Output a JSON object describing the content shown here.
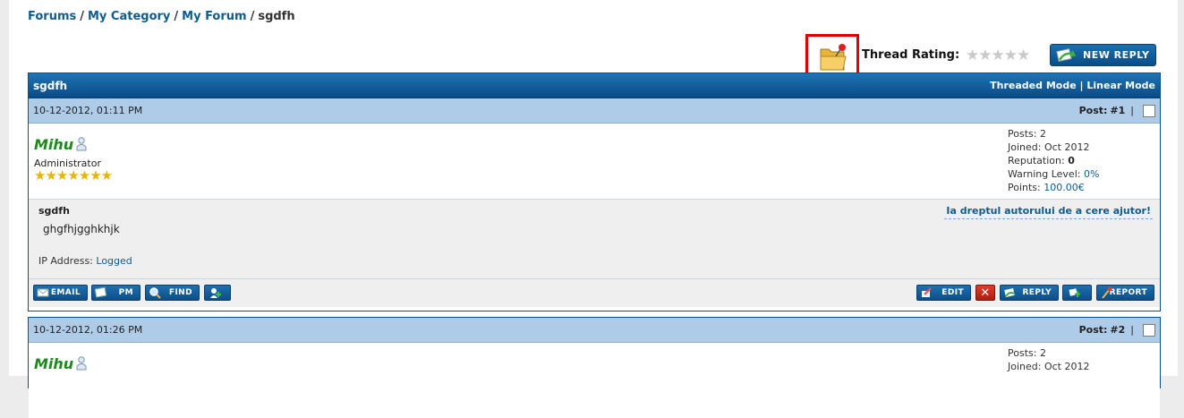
{
  "breadcrumb": {
    "forums": "Forums",
    "category": "My Category",
    "forum": "My Forum",
    "thread": "sgdfh",
    "sep": "/"
  },
  "thread_tools": {
    "rating_label": "Thread Rating:",
    "stars": "★★★★★",
    "new_reply": "NEW REPLY"
  },
  "thread": {
    "title": "sgdfh",
    "threaded_mode": "Threaded Mode",
    "linear_mode": "Linear Mode",
    "mode_sep": "|"
  },
  "posts": [
    {
      "date": "10-12-2012, 01:11 PM",
      "post_label": "Post:",
      "post_num": "#1",
      "post_sep": "|",
      "username": "Mihu",
      "user_title": "Administrator",
      "user_stars": "★★★★★★★",
      "posts_label": "Posts:",
      "posts": "2",
      "joined_label": "Joined:",
      "joined": "Oct 2012",
      "rep_label": "Reputation:",
      "rep": "0",
      "warn_label": "Warning Level:",
      "warn": "0%",
      "points_label": "Points:",
      "points": "100.00€",
      "subject": "sgdfh",
      "message": "ghgfhjgghkhjk",
      "ip_label": "IP Address:",
      "ip_value": "Logged",
      "help_link": "Ia dreptul autorului de a cere ajutor!",
      "buttons": {
        "email": "EMAIL",
        "pm": "PM",
        "find": "FIND",
        "edit": "EDIT",
        "delete": "✕",
        "reply": "REPLY",
        "report": "REPORT"
      }
    },
    {
      "date": "10-12-2012, 01:26 PM",
      "post_label": "Post:",
      "post_num": "#2",
      "post_sep": "|",
      "username": "Mihu",
      "posts_label": "Posts:",
      "posts": "2",
      "joined_label": "Joined:",
      "joined": "Oct 2012"
    }
  ],
  "colors": {
    "accent": "#0b4d86",
    "link": "#0f5c8e",
    "username": "#1a8a1a",
    "highlight_box": "#e00000"
  },
  "icons": {
    "folder": "folder-pin-icon",
    "online_status": "user-offline-icon"
  }
}
